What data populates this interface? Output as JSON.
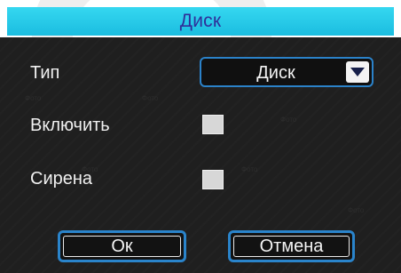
{
  "dialog": {
    "title": "Диск",
    "fields": [
      {
        "label": "Тип",
        "value": "Диск"
      },
      {
        "label": "Включить",
        "checked": false
      },
      {
        "label": "Сирена",
        "checked": false
      }
    ],
    "buttons": {
      "ok": "Ок",
      "cancel": "Отмена"
    }
  },
  "icons": {
    "dropdown_arrow": "chevron-down-icon"
  },
  "colors": {
    "title_bar": "#1bbde0",
    "title_text": "#2f2f9a",
    "background": "#1f1f1f",
    "focus_border": "#2b82c9",
    "text": "#f0f0f0",
    "checkbox": "#d7d7d7"
  }
}
